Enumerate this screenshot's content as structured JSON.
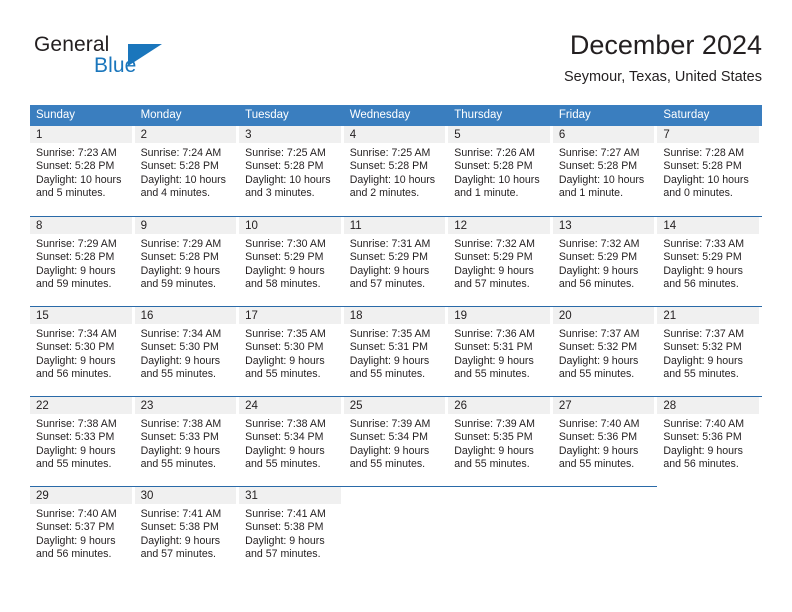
{
  "brand": {
    "name_top": "General",
    "name_bottom": "Blue",
    "accent_color": "#1a76bc",
    "triangle_icon": "triangle-icon"
  },
  "header": {
    "month_title": "December 2024",
    "location": "Seymour, Texas, United States"
  },
  "theme": {
    "header_bg": "#3a7ebf",
    "week_divider": "#2a6aa8",
    "date_band_bg": "#f0f0f0",
    "text": "#231f20"
  },
  "calendar": {
    "weekday_headers": [
      "Sunday",
      "Monday",
      "Tuesday",
      "Wednesday",
      "Thursday",
      "Friday",
      "Saturday"
    ],
    "weeks": [
      [
        {
          "date": "1",
          "info": "Sunrise: 7:23 AM\nSunset: 5:28 PM\nDaylight: 10 hours\nand 5 minutes."
        },
        {
          "date": "2",
          "info": "Sunrise: 7:24 AM\nSunset: 5:28 PM\nDaylight: 10 hours\nand 4 minutes."
        },
        {
          "date": "3",
          "info": "Sunrise: 7:25 AM\nSunset: 5:28 PM\nDaylight: 10 hours\nand 3 minutes."
        },
        {
          "date": "4",
          "info": "Sunrise: 7:25 AM\nSunset: 5:28 PM\nDaylight: 10 hours\nand 2 minutes."
        },
        {
          "date": "5",
          "info": "Sunrise: 7:26 AM\nSunset: 5:28 PM\nDaylight: 10 hours\nand 1 minute."
        },
        {
          "date": "6",
          "info": "Sunrise: 7:27 AM\nSunset: 5:28 PM\nDaylight: 10 hours\nand 1 minute."
        },
        {
          "date": "7",
          "info": "Sunrise: 7:28 AM\nSunset: 5:28 PM\nDaylight: 10 hours\nand 0 minutes."
        }
      ],
      [
        {
          "date": "8",
          "info": "Sunrise: 7:29 AM\nSunset: 5:28 PM\nDaylight: 9 hours\nand 59 minutes."
        },
        {
          "date": "9",
          "info": "Sunrise: 7:29 AM\nSunset: 5:28 PM\nDaylight: 9 hours\nand 59 minutes."
        },
        {
          "date": "10",
          "info": "Sunrise: 7:30 AM\nSunset: 5:29 PM\nDaylight: 9 hours\nand 58 minutes."
        },
        {
          "date": "11",
          "info": "Sunrise: 7:31 AM\nSunset: 5:29 PM\nDaylight: 9 hours\nand 57 minutes."
        },
        {
          "date": "12",
          "info": "Sunrise: 7:32 AM\nSunset: 5:29 PM\nDaylight: 9 hours\nand 57 minutes."
        },
        {
          "date": "13",
          "info": "Sunrise: 7:32 AM\nSunset: 5:29 PM\nDaylight: 9 hours\nand 56 minutes."
        },
        {
          "date": "14",
          "info": "Sunrise: 7:33 AM\nSunset: 5:29 PM\nDaylight: 9 hours\nand 56 minutes."
        }
      ],
      [
        {
          "date": "15",
          "info": "Sunrise: 7:34 AM\nSunset: 5:30 PM\nDaylight: 9 hours\nand 56 minutes."
        },
        {
          "date": "16",
          "info": "Sunrise: 7:34 AM\nSunset: 5:30 PM\nDaylight: 9 hours\nand 55 minutes."
        },
        {
          "date": "17",
          "info": "Sunrise: 7:35 AM\nSunset: 5:30 PM\nDaylight: 9 hours\nand 55 minutes."
        },
        {
          "date": "18",
          "info": "Sunrise: 7:35 AM\nSunset: 5:31 PM\nDaylight: 9 hours\nand 55 minutes."
        },
        {
          "date": "19",
          "info": "Sunrise: 7:36 AM\nSunset: 5:31 PM\nDaylight: 9 hours\nand 55 minutes."
        },
        {
          "date": "20",
          "info": "Sunrise: 7:37 AM\nSunset: 5:32 PM\nDaylight: 9 hours\nand 55 minutes."
        },
        {
          "date": "21",
          "info": "Sunrise: 7:37 AM\nSunset: 5:32 PM\nDaylight: 9 hours\nand 55 minutes."
        }
      ],
      [
        {
          "date": "22",
          "info": "Sunrise: 7:38 AM\nSunset: 5:33 PM\nDaylight: 9 hours\nand 55 minutes."
        },
        {
          "date": "23",
          "info": "Sunrise: 7:38 AM\nSunset: 5:33 PM\nDaylight: 9 hours\nand 55 minutes."
        },
        {
          "date": "24",
          "info": "Sunrise: 7:38 AM\nSunset: 5:34 PM\nDaylight: 9 hours\nand 55 minutes."
        },
        {
          "date": "25",
          "info": "Sunrise: 7:39 AM\nSunset: 5:34 PM\nDaylight: 9 hours\nand 55 minutes."
        },
        {
          "date": "26",
          "info": "Sunrise: 7:39 AM\nSunset: 5:35 PM\nDaylight: 9 hours\nand 55 minutes."
        },
        {
          "date": "27",
          "info": "Sunrise: 7:40 AM\nSunset: 5:36 PM\nDaylight: 9 hours\nand 55 minutes."
        },
        {
          "date": "28",
          "info": "Sunrise: 7:40 AM\nSunset: 5:36 PM\nDaylight: 9 hours\nand 56 minutes."
        }
      ],
      [
        {
          "date": "29",
          "info": "Sunrise: 7:40 AM\nSunset: 5:37 PM\nDaylight: 9 hours\nand 56 minutes."
        },
        {
          "date": "30",
          "info": "Sunrise: 7:41 AM\nSunset: 5:38 PM\nDaylight: 9 hours\nand 57 minutes."
        },
        {
          "date": "31",
          "info": "Sunrise: 7:41 AM\nSunset: 5:38 PM\nDaylight: 9 hours\nand 57 minutes."
        },
        {
          "date": "",
          "info": ""
        },
        {
          "date": "",
          "info": ""
        },
        {
          "date": "",
          "info": ""
        },
        {
          "date": "",
          "info": ""
        }
      ]
    ]
  }
}
